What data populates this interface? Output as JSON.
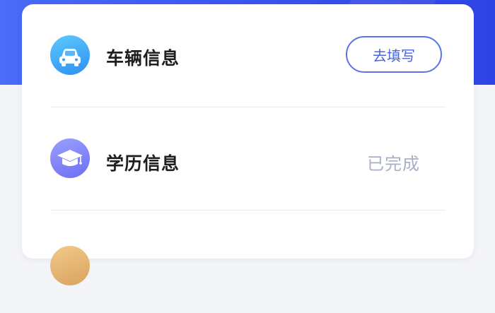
{
  "items": [
    {
      "label": "车辆信息",
      "icon": "car-icon",
      "action_label": "去填写"
    },
    {
      "label": "学历信息",
      "icon": "graduation-cap-icon",
      "status_label": "已完成"
    },
    {
      "icon": "badge-icon"
    }
  ],
  "colors": {
    "header_gradient_start": "#4a6cf7",
    "header_gradient_end": "#2f44e6",
    "button_border": "#5b73e8",
    "status_completed": "#a7b1c6"
  }
}
